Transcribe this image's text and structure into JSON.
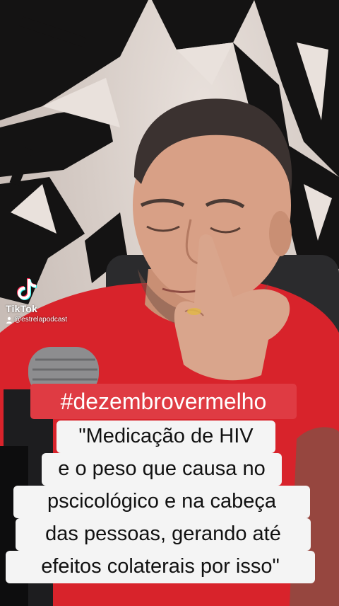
{
  "watermark": {
    "brand": "TikTok",
    "username": "@estrelapodcast",
    "logo_icon": "tiktok-note-icon",
    "user_icon": "user-icon"
  },
  "captions": {
    "hashtag": "#dezembrovermelho",
    "quote_lines": [
      "\"Medicação de HIV",
      "e o peso que causa no",
      "pscicológico e na cabeça",
      "das pessoas, gerando até",
      "efeitos colaterais por isso\""
    ]
  },
  "colors": {
    "hashtag_bg": "#df3b43",
    "caption_bg": "#f4f4f4",
    "shirt": "#d8232b",
    "mural_dark": "#141313"
  }
}
